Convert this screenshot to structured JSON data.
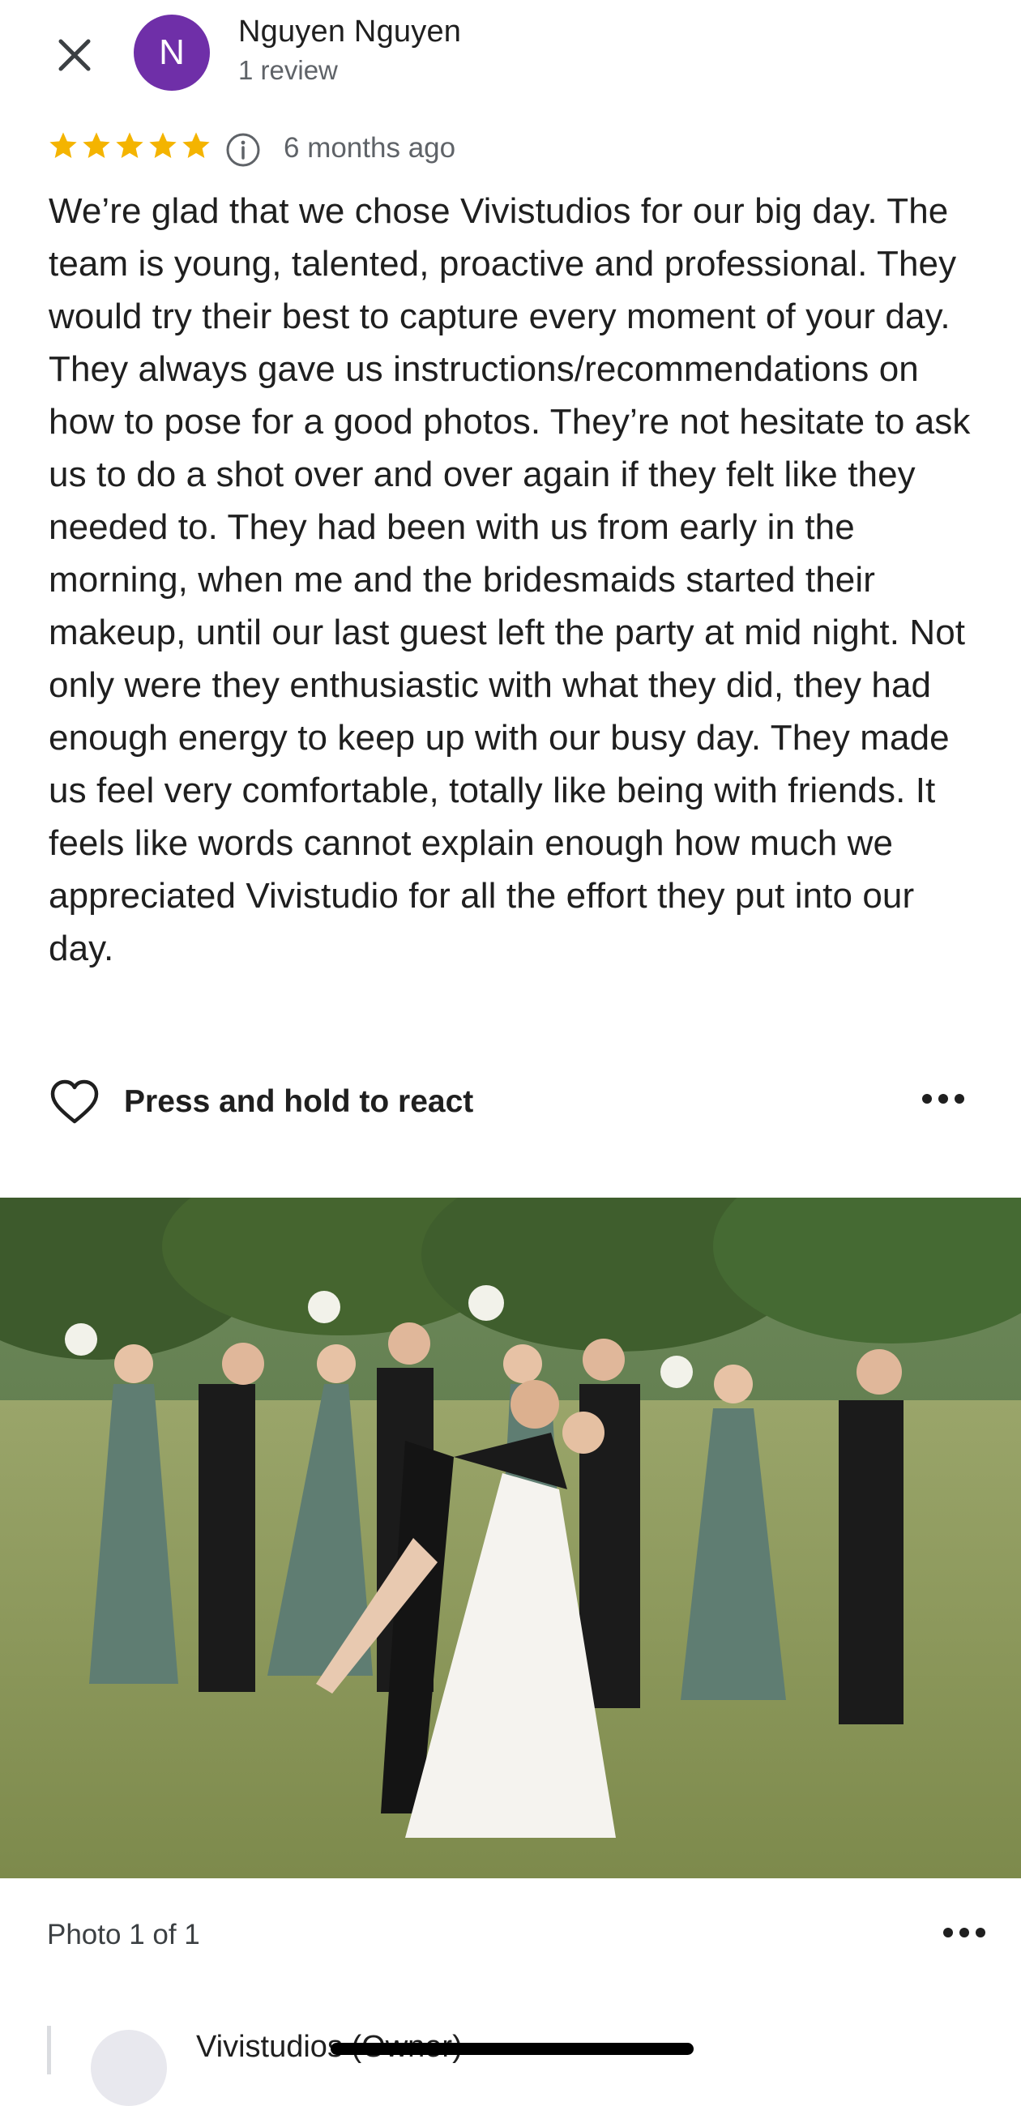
{
  "header": {
    "avatar_letter": "N",
    "author_name": "Nguyen Nguyen",
    "review_count": "1 review"
  },
  "rating": {
    "stars": 5,
    "max_stars": 5,
    "date": "6 months ago"
  },
  "review": {
    "text": "We’re glad that we chose Vivistudios for our big day. The team is young, talented, proactive and professional. They would try their best to capture every moment of your day. They always gave us instructions/recommendations on how to pose for a good photos. They’re not hesitate to ask us to do a shot over and over again if they felt like they needed to. They had been with us from early in the morning, when me and the bridesmaids started their makeup, until our last guest left the party at mid night. Not only were they enthusiastic with what they did, they had enough energy to keep up with our busy day. They made us feel very comfortable, totally like being with friends. It feels like words cannot explain enough how much we appreciated Vivistudio for all the effort they put into our day."
  },
  "reaction": {
    "label": "Press and hold to react"
  },
  "photo": {
    "counter": "Photo 1 of 1"
  },
  "owner_reply": {
    "name": "Vivistudios (Owner)"
  },
  "colors": {
    "avatar": "#6f2fa8",
    "star": "#f4b400",
    "text": "#1f1f1f",
    "secondary": "#5f6368"
  },
  "icons": {
    "close": "close-icon",
    "info": "info-icon",
    "heart": "heart-outline-icon",
    "more": "more-horiz-icon"
  }
}
